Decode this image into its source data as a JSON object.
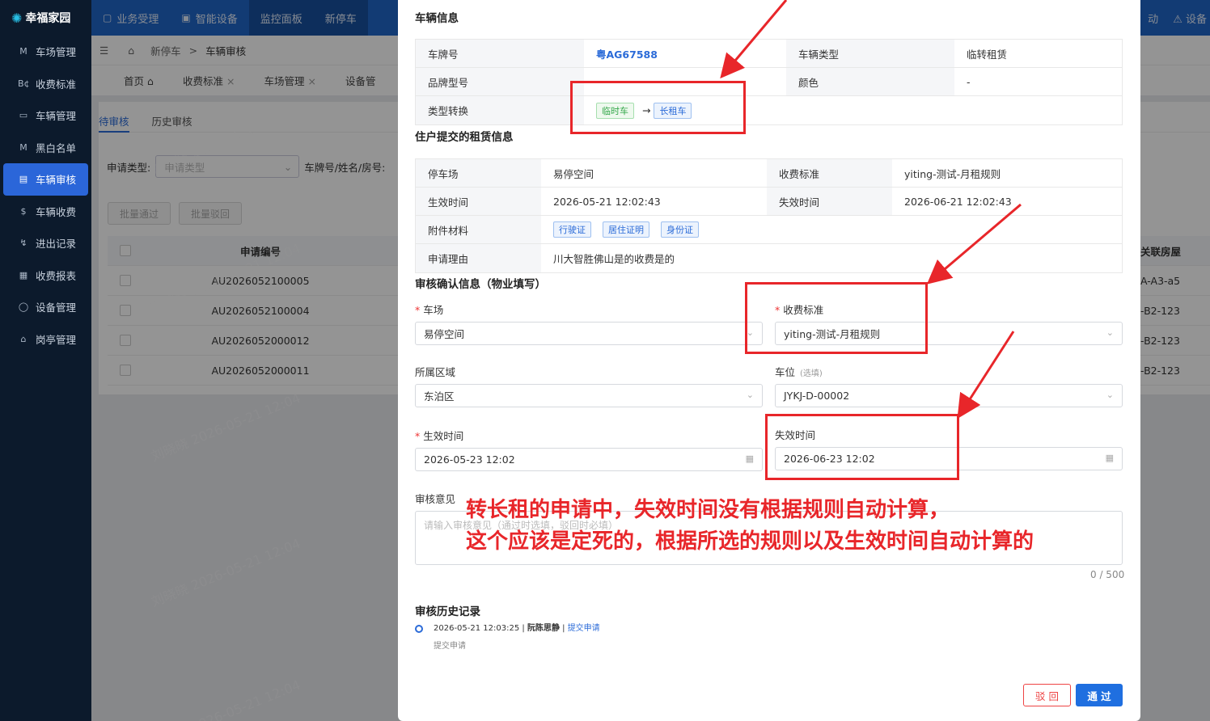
{
  "app": {
    "name": "幸福家园"
  },
  "topnav": {
    "items": [
      "业务受理",
      "智能设备",
      "监控面板",
      "新停车"
    ],
    "right": [
      "动",
      "设备"
    ]
  },
  "sidebar": {
    "items": [
      {
        "icon": "M",
        "label": "车场管理"
      },
      {
        "icon": "B¢",
        "label": "收费标准"
      },
      {
        "icon": "▭",
        "label": "车辆管理"
      },
      {
        "icon": "M",
        "label": "黑白名单"
      },
      {
        "icon": "▤",
        "label": "车辆审核"
      },
      {
        "icon": "$",
        "label": "车辆收费"
      },
      {
        "icon": "↯",
        "label": "进出记录"
      },
      {
        "icon": "▦",
        "label": "收费报表"
      },
      {
        "icon": "◯",
        "label": "设备管理"
      },
      {
        "icon": "⌂",
        "label": "岗亭管理"
      }
    ]
  },
  "breadcrumb": {
    "items": [
      "新停车",
      "车辆审核"
    ],
    "sep": ">"
  },
  "tabs": [
    {
      "label": "首页"
    },
    {
      "label": "收费标准"
    },
    {
      "label": "车场管理"
    },
    {
      "label": "设备管"
    }
  ],
  "subtabs": [
    "待审核",
    "历史审核"
  ],
  "filter": {
    "type_label": "申请类型:",
    "type_placeholder": "申请类型",
    "plate_label": "车牌号/姓名/房号:"
  },
  "batch": {
    "approve": "批量通过",
    "reject": "批量驳回"
  },
  "table": {
    "headers": {
      "no": "申请编号",
      "house": "关联房屋"
    },
    "rows": [
      {
        "no": "AU2026052100005",
        "house": "A-A3-a5"
      },
      {
        "no": "AU2026052100004",
        "house": "-B2-123"
      },
      {
        "no": "AU2026052000012",
        "house": "-B2-123"
      },
      {
        "no": "AU2026052000011",
        "house": "-B2-123"
      }
    ]
  },
  "watermark": "刘晓晓 2026-05-21 12:04",
  "dialog": {
    "vehicle": {
      "title": "车辆信息",
      "plate_label": "车牌号",
      "plate": "粤AG67588",
      "vtype_label": "车辆类型",
      "vtype": "临转租赁",
      "brand_label": "品牌型号",
      "brand": "",
      "color_label": "颜色",
      "color": "-",
      "convert_label": "类型转换",
      "from": "临时车",
      "arrow": "→",
      "to": "长租车"
    },
    "lease": {
      "title": "住户提交的租赁信息",
      "lot_label": "停车场",
      "lot": "易停空间",
      "std_label": "收费标准",
      "std": "yiting-测试-月租规则",
      "start_label": "生效时间",
      "start": "2026-05-21 12:02:43",
      "end_label": "失效时间",
      "end": "2026-06-21 12:02:43",
      "attach_label": "附件材料",
      "attachments": [
        "行驶证",
        "居住证明",
        "身份证"
      ],
      "reason_label": "申请理由",
      "reason": "川大智胜佛山是的收费是的"
    },
    "confirm": {
      "title": "审核确认信息（物业填写）",
      "lot_label": "车场",
      "lot": "易停空间",
      "std_label": "收费标准",
      "std": "yiting-测试-月租规则",
      "area_label": "所属区域",
      "area": "东泊区",
      "space_label": "车位",
      "space_opt": "(选填)",
      "space": "JYKJ-D-00002",
      "start_label": "生效时间",
      "start": "2026-05-23 12:02",
      "end_label": "失效时间",
      "end": "2026-06-23 12:02",
      "opinion_label": "审核意见",
      "opinion_placeholder": "请输入审核意见（通过时选填，驳回时必填）",
      "count": "0 / 500"
    },
    "history": {
      "title": "审核历史记录",
      "time": "2026-05-21 12:03:25",
      "user": "阮陈思静",
      "action": "提交申请",
      "desc": "提交申请"
    },
    "buttons": {
      "reject": "驳 回",
      "approve": "通 过"
    }
  },
  "annotation": {
    "line1": "转长租的申请中，失效时间没有根据规则自动计算，",
    "line2": "这个应该是定死的，根据所选的规则以及生效时间自动计算的",
    "color": "#e8262a"
  }
}
